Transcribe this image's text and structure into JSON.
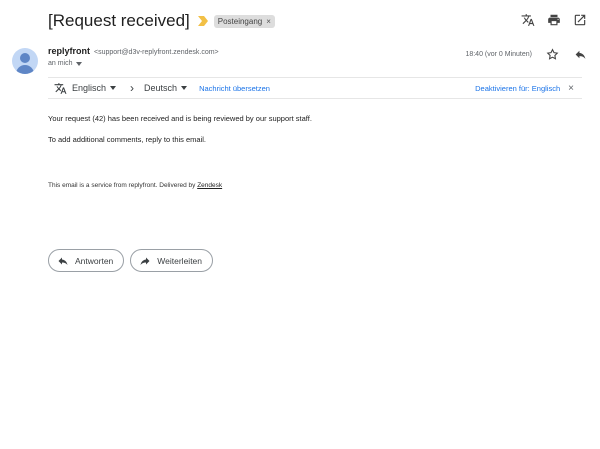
{
  "email": {
    "subject": "[Request received]",
    "label": "Posteingang",
    "label_remove": "×"
  },
  "sender": {
    "name": "replyfront",
    "email": "<support@d3v-replyfront.zendesk.com>",
    "recipient": "an mich",
    "time": "18:40 (vor 0 Minuten)"
  },
  "translate_bar": {
    "source_lang": "Englisch",
    "arrow": "›",
    "target_lang": "Deutsch",
    "translate_link": "Nachricht übersetzen",
    "disable_label": "Deaktivieren für: Englisch",
    "close": "×"
  },
  "body": {
    "line1": "Your request (42) has been received and is being reviewed by our support staff.",
    "line2": "To add additional comments, reply to this email.",
    "footer_prefix": "This email is a service from replyfront. Delivered by ",
    "footer_link": "Zendesk"
  },
  "actions": {
    "reply": "Antworten",
    "forward": "Weiterleiten"
  },
  "icons": {
    "translate": "translate-icon",
    "print": "print-icon",
    "open_new_window": "open-in-new-icon",
    "star": "star-icon",
    "reply": "reply-icon",
    "forward": "forward-icon",
    "important": "important-marker-icon"
  },
  "colors": {
    "link": "#1a73e8",
    "important_marker": "#f2c046",
    "avatar_bg": "#c2d7f5"
  }
}
